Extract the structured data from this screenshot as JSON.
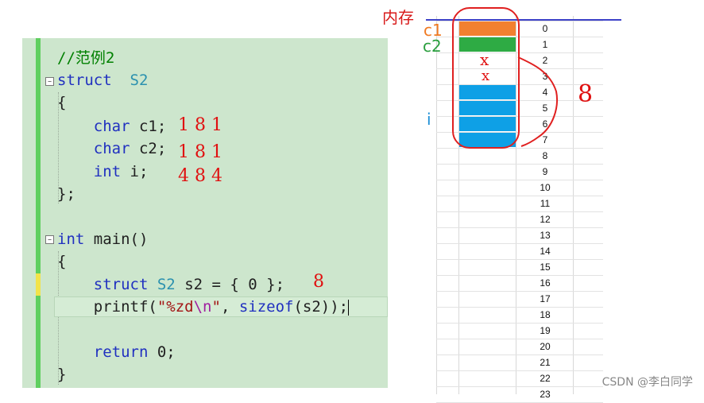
{
  "editor": {
    "lines": [
      {
        "parts": [
          [
            "cm",
            "//范例2"
          ]
        ]
      },
      {
        "parts": [
          [
            "kw",
            "struct"
          ],
          [
            "",
            "  "
          ],
          [
            "ty",
            "S2"
          ]
        ]
      },
      {
        "parts": [
          [
            "",
            "{"
          ]
        ]
      },
      {
        "parts": [
          [
            "",
            "    "
          ],
          [
            "kw",
            "char"
          ],
          [
            "",
            " c1;"
          ]
        ]
      },
      {
        "parts": [
          [
            "",
            "    "
          ],
          [
            "kw",
            "char"
          ],
          [
            "",
            " c2;"
          ]
        ]
      },
      {
        "parts": [
          [
            "",
            "    "
          ],
          [
            "kw",
            "int"
          ],
          [
            "",
            " i;"
          ]
        ]
      },
      {
        "parts": [
          [
            "",
            "};"
          ]
        ]
      },
      {
        "parts": [
          [
            "",
            ""
          ]
        ]
      },
      {
        "parts": [
          [
            "kw",
            "int"
          ],
          [
            "",
            " main()"
          ]
        ]
      },
      {
        "parts": [
          [
            "",
            "{"
          ]
        ]
      },
      {
        "parts": [
          [
            "",
            "    "
          ],
          [
            "kw",
            "struct"
          ],
          [
            "",
            " "
          ],
          [
            "ty",
            "S2"
          ],
          [
            "",
            " s2 = { 0 };"
          ]
        ]
      },
      {
        "parts": [
          [
            "",
            "    printf("
          ],
          [
            "st",
            "\"%zd"
          ],
          [
            "esc",
            "\\n"
          ],
          [
            "st",
            "\""
          ],
          [
            "",
            ", "
          ],
          [
            "kw",
            "sizeof"
          ],
          [
            "",
            "(s2));"
          ]
        ]
      },
      {
        "parts": [
          [
            "",
            ""
          ]
        ]
      },
      {
        "parts": [
          [
            "",
            "    "
          ],
          [
            "kw",
            "return"
          ],
          [
            "",
            " 0;"
          ]
        ]
      },
      {
        "parts": [
          [
            "",
            "}"
          ]
        ]
      }
    ],
    "annotations": {
      "c1_align": "1 8 1",
      "c2_align": "1 8 1",
      "i_align": "4 8 4",
      "result": "8"
    }
  },
  "memory": {
    "title": "内存",
    "labels": {
      "c1": "c1",
      "c2": "c2",
      "i": "i"
    },
    "rows": [
      "0",
      "1",
      "2",
      "3",
      "4",
      "5",
      "6",
      "7",
      "8",
      "9",
      "10",
      "11",
      "12",
      "13",
      "14",
      "15",
      "16",
      "17",
      "18",
      "19",
      "20",
      "21",
      "22",
      "23"
    ],
    "cell_colors": {
      "0": "#f28030",
      "1": "#2eab44",
      "4": "#0ea0e6",
      "5": "#0ea0e6",
      "6": "#0ea0e6",
      "7": "#0ea0e6"
    },
    "wasted_marks": [
      "x",
      "x"
    ],
    "total_note": "8"
  },
  "watermark": "CSDN @李白同学"
}
